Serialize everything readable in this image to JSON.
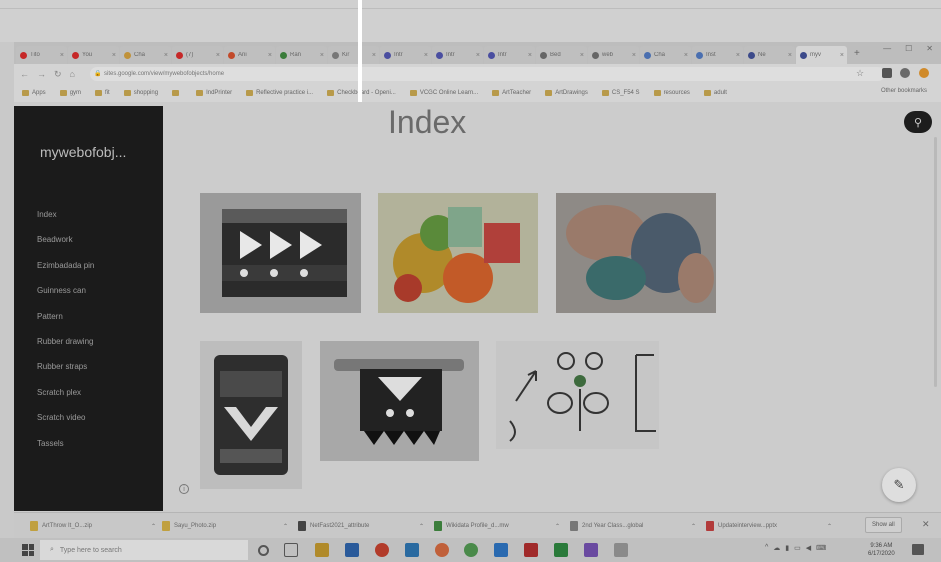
{
  "browser": {
    "tabs": [
      {
        "label": "Tito",
        "icon": "youtube-icon",
        "color": "#c62828"
      },
      {
        "label": "You",
        "icon": "youtube-icon",
        "color": "#c62828"
      },
      {
        "label": "Cha",
        "icon": "folder-icon",
        "color": "#c0923a"
      },
      {
        "label": "(7)",
        "icon": "youtube-icon",
        "color": "#c62828"
      },
      {
        "label": "Ani",
        "icon": "record-icon",
        "color": "#c24a2a"
      },
      {
        "label": "Ran",
        "icon": "drive-icon",
        "color": "#3b7d3b"
      },
      {
        "label": "Kir",
        "icon": "gear-icon",
        "color": "#777777"
      },
      {
        "label": "Intr",
        "icon": "teams-icon",
        "color": "#4a4ea0"
      },
      {
        "label": "Intr",
        "icon": "teams-icon",
        "color": "#4a4ea0"
      },
      {
        "label": "Intr",
        "icon": "teams-icon",
        "color": "#4a4ea0"
      },
      {
        "label": "Bed",
        "icon": "tool-icon",
        "color": "#666666"
      },
      {
        "label": "web",
        "icon": "globe-icon",
        "color": "#666666"
      },
      {
        "label": "Cha",
        "icon": "doc-icon",
        "color": "#4a6fb0"
      },
      {
        "label": "Inst",
        "icon": "doc-icon",
        "color": "#4a6fb0"
      },
      {
        "label": "Ne",
        "icon": "doc-icon",
        "color": "#3c4a8a"
      },
      {
        "label": "myv",
        "icon": "sites-icon",
        "color": "#3c4a8a"
      }
    ],
    "active_tab_index": 15,
    "address": "sites.google.com/view/mywebofobjects/home",
    "bookmarks": [
      "Apps",
      "gym",
      "fit",
      "shopping",
      "",
      "IndPrinter",
      "Reflective practice i...",
      "Checkboard - Openi...",
      "VCGC Online Learn...",
      "ArtTeacher",
      "ArtDrawings",
      "CS_F54 S",
      "resources",
      "adult"
    ],
    "other_bookmarks": "Other bookmarks"
  },
  "site": {
    "title": "mywebofobj...",
    "page_title": "Index",
    "nav": [
      "Index",
      "Beadwork",
      "Ezimbadada pin",
      "Guinness can",
      "Pattern",
      "Rubber drawing",
      "Rubber straps",
      "Scratch plex",
      "Scratch video",
      "Tassels"
    ]
  },
  "downloads": {
    "items": [
      {
        "name": "ArtThrow It_O...zip",
        "color": "#c0a040"
      },
      {
        "name": "Sayu_Photo.zip",
        "color": "#c0a040"
      },
      {
        "name": "NetFast2021_attribute",
        "color": "#444444"
      },
      {
        "name": "Wikidata Profile_d...mw",
        "color": "#3b7d3b"
      },
      {
        "name": "2nd Year Class...global",
        "color": "#777777"
      },
      {
        "name": "Updateinterview...pptx",
        "color": "#b23b3b"
      }
    ],
    "show_all": "Show all"
  },
  "taskbar": {
    "search_placeholder": "Type here to search",
    "time": "9:36 AM",
    "date": "6/17/2020"
  },
  "colors": {
    "sidebar": "#1b1b1b",
    "page_bg": "#cccccc",
    "accent": "#1d1d1d"
  }
}
